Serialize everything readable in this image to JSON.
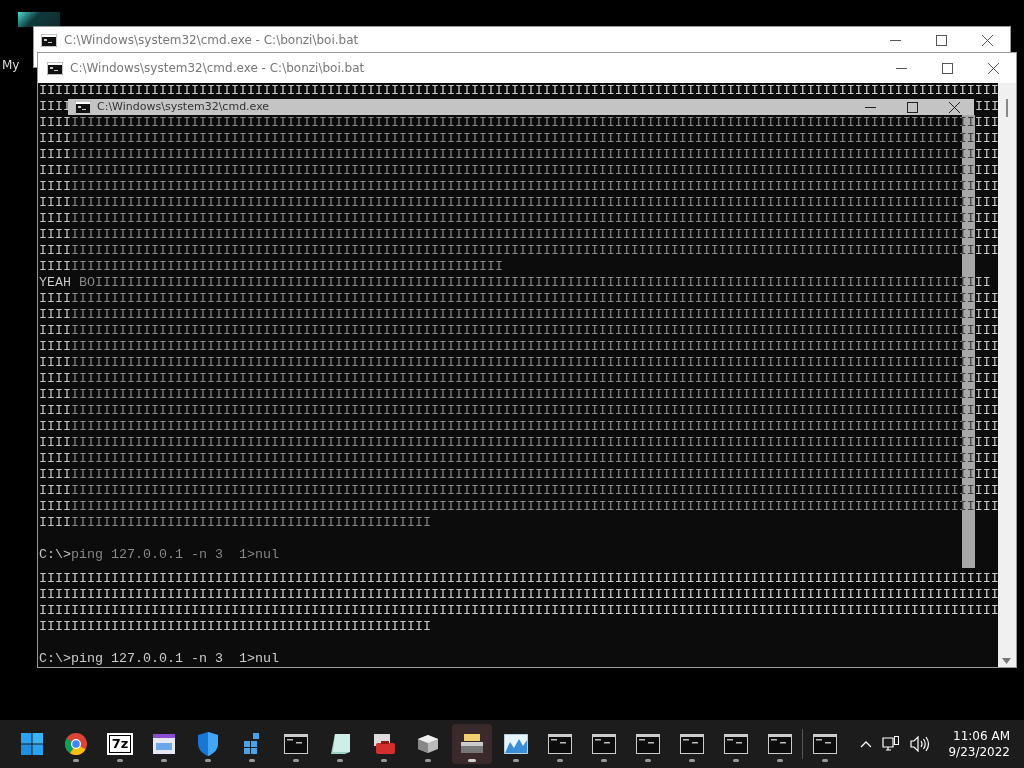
{
  "desktop": {
    "icon_labels": [
      "My"
    ]
  },
  "back_window": {
    "title": "C:\\Windows\\system32\\cmd.exe - C:\\bonzi\\boi.bat"
  },
  "front_window": {
    "title": "C:\\Windows\\system32\\cmd.exe - C:\\bonzi\\boi.bat",
    "console": [
      {
        "kind": "output",
        "dimmed": false,
        "lines": [
          "IIIIIIIIIIIIIIIIIIIIIIIIIIIIIIIIIIIIIIIIIIIIIIIIIIIIIIIIIIIIIIIIIIIIIIIIIIIIIIIIIIIIIIIIIIIIIIIIIIIIIIIIIIIIIIIIIIIIIIII"
        ]
      },
      {
        "kind": "covered",
        "left": "IIII",
        "right": "III"
      },
      {
        "kind": "output",
        "dimmed": true,
        "lines": [
          "IIIIIIIIIIIIIIIIIIIIIIIIIIIIIIIIIIIIIIIIIIIIIIIIIIIIIIIIIIIIIIIIIIIIIIIIIIIIIIIIIIIIIIIIIIIIIIIIIIIIIIIIIIIIIIIIIIIIIIII",
          "IIIIIIIIIIIIIIIIIIIIIIIIIIIIIIIIIIIIIIIIIIIIIIIIIIIIIIIIIIIIIIIIIIIIIIIIIIIIIIIIIIIIIIIIIIIIIIIIIIIIIIIIIIIIIIIIIIIIIIII",
          "IIIIIIIIIIIIIIIIIIIIIIIIIIIIIIIIIIIIIIIIIIIIIIIIIIIIIIIIIIIIIIIIIIIIIIIIIIIIIIIIIIIIIIIIIIIIIIIIIIIIIIIIIIIIIIIIIIIIIIII",
          "IIIIIIIIIIIIIIIIIIIIIIIIIIIIIIIIIIIIIIIIIIIIIIIIIIIIIIIIIIIIIIIIIIIIIIIIIIIIIIIIIIIIIIIIIIIIIIIIIIIIIIIIIIIIIIIIIIIIIIII",
          "IIIIIIIIIIIIIIIIIIIIIIIIIIIIIIIIIIIIIIIIIIIIIIIIIIIIIIIIIIIIIIIIIIIIIIIIIIIIIIIIIIIIIIIIIIIIIIIIIIIIIIIIIIIIIIIIIIIIIIII",
          "IIIIIIIIIIIIIIIIIIIIIIIIIIIIIIIIIIIIIIIIIIIIIIIIIIIIIIIIIIIIIIIIIIIIIIIIIIIIIIIIIIIIIIIIIIIIIIIIIIIIIIIIIIIIIIIIIIIIIIII",
          "IIIIIIIIIIIIIIIIIIIIIIIIIIIIIIIIIIIIIIIIIIIIIIIIIIIIIIIIIIIIIIIIIIIIIIIIIIIIIIIIIIIIIIIIIIIIIIIIIIIIIIIIIIIIIIIIIIIIIIII",
          "IIIIIIIIIIIIIIIIIIIIIIIIIIIIIIIIIIIIIIIIIIIIIIIIIIIIIIIIIIIIIIIIIIIIIIIIIIIIIIIIIIIIIIIIIIIIIIIIIIIIIIIIIIIIIIIIIIIIIIII",
          "IIIIIIIIIIIIIIIIIIIIIIIIIIIIIIIIIIIIIIIIIIIIIIIIIIIIIIIIIIIIIIIIIIIIIIIIIIIIIIIIIIIIIIIIIIIIIIIIIIIIIIIIIIIIIIIIIIIIIIII",
          "IIIIIIIIIIIIIIIIIIIIIIIIIIIIIIIIIIIIIIIIIIIIIIIIIIIIIIIIII",
          "YEAH BOIIIIIIIIIIIIIIIIIIIIIIIIIIIIIIIIIIIIIIIIIIIIIIIIIIIIIIIIIIIIIIIIIIIIIIIIIIIIIIIIIIIIIIIIIIIIIIIIIIIIIIIIIIIIIIII",
          "IIIIIIIIIIIIIIIIIIIIIIIIIIIIIIIIIIIIIIIIIIIIIIIIIIIIIIIIIIIIIIIIIIIIIIIIIIIIIIIIIIIIIIIIIIIIIIIIIIIIIIIIIIIIIIIIIIIIIIII",
          "IIIIIIIIIIIIIIIIIIIIIIIIIIIIIIIIIIIIIIIIIIIIIIIIIIIIIIIIIIIIIIIIIIIIIIIIIIIIIIIIIIIIIIIIIIIIIIIIIIIIIIIIIIIIIIIIIIIIIIII",
          "IIIIIIIIIIIIIIIIIIIIIIIIIIIIIIIIIIIIIIIIIIIIIIIIIIIIIIIIIIIIIIIIIIIIIIIIIIIIIIIIIIIIIIIIIIIIIIIIIIIIIIIIIIIIIIIIIIIIIIII",
          "IIIIIIIIIIIIIIIIIIIIIIIIIIIIIIIIIIIIIIIIIIIIIIIIIIIIIIIIIIIIIIIIIIIIIIIIIIIIIIIIIIIIIIIIIIIIIIIIIIIIIIIIIIIIIIIIIIIIIIII",
          "IIIIIIIIIIIIIIIIIIIIIIIIIIIIIIIIIIIIIIIIIIIIIIIIIIIIIIIIIIIIIIIIIIIIIIIIIIIIIIIIIIIIIIIIIIIIIIIIIIIIIIIIIIIIIIIIIIIIIIII",
          "IIIIIIIIIIIIIIIIIIIIIIIIIIIIIIIIIIIIIIIIIIIIIIIIIIIIIIIIIIIIIIIIIIIIIIIIIIIIIIIIIIIIIIIIIIIIIIIIIIIIIIIIIIIIIIIIIIIIIIII",
          "IIIIIIIIIIIIIIIIIIIIIIIIIIIIIIIIIIIIIIIIIIIIIIIIIIIIIIIIIIIIIIIIIIIIIIIIIIIIIIIIIIIIIIIIIIIIIIIIIIIIIIIIIIIIIIIIIIIIIIII",
          "IIIIIIIIIIIIIIIIIIIIIIIIIIIIIIIIIIIIIIIIIIIIIIIIIIIIIIIIIIIIIIIIIIIIIIIIIIIIIIIIIIIIIIIIIIIIIIIIIIIIIIIIIIIIIIIIIIIIIIII",
          "IIIIIIIIIIIIIIIIIIIIIIIIIIIIIIIIIIIIIIIIIIIIIIIIIIIIIIIIIIIIIIIIIIIIIIIIIIIIIIIIIIIIIIIIIIIIIIIIIIIIIIIIIIIIIIIIIIIIIIII",
          "IIIIIIIIIIIIIIIIIIIIIIIIIIIIIIIIIIIIIIIIIIIIIIIIIIIIIIIIIIIIIIIIIIIIIIIIIIIIIIIIIIIIIIIIIIIIIIIIIIIIIIIIIIIIIIIIIIIIIIII",
          "IIIIIIIIIIIIIIIIIIIIIIIIIIIIIIIIIIIIIIIIIIIIIIIIIIIIIIIIIIIIIIIIIIIIIIIIIIIIIIIIIIIIIIIIIIIIIIIIIIIIIIIIIIIIIIIIIIIIIIII",
          "IIIIIIIIIIIIIIIIIIIIIIIIIIIIIIIIIIIIIIIIIIIIIIIIIIIIIIIIIIIIIIIIIIIIIIIIIIIIIIIIIIIIIIIIIIIIIIIIIIIIIIIIIIIIIIIIIIIIIIII",
          "IIIIIIIIIIIIIIIIIIIIIIIIIIIIIIIIIIIIIIIIIIIIIIIIIIIIIIIIIIIIIIIIIIIIIIIIIIIIIIIIIIIIIIIIIIIIIIIIIIIIIIIIIIIIIIIIIIIIIIII",
          "IIIIIIIIIIIIIIIIIIIIIIIIIIIIIIIIIIIIIIIIIIIIIIIIIIIIIIIIIIIIIIIIIIIIIIIIIIIIIIIIIIIIIIIIIIIIIIIIIIIIIIIIIIIIIIIIIIIIIIII",
          "IIIIIIIIIIIIIIIIIIIIIIIIIIIIIIIIIIIIIIIIIIIIIIIII"
        ]
      },
      {
        "kind": "prompt",
        "dimmed": true,
        "text": "C:\\>ping 127.0.0.1 -n 3  1>nul"
      },
      {
        "kind": "output",
        "dimmed": false,
        "lines": [
          "IIIIIIIIIIIIIIIIIIIIIIIIIIIIIIIIIIIIIIIIIIIIIIIIIIIIIIIIIIIIIIIIIIIIIIIIIIIIIIIIIIIIIIIIIIIIIIIIIIIIIIIIIIIIIIIIIIIIIIII",
          "IIIIIIIIIIIIIIIIIIIIIIIIIIIIIIIIIIIIIIIIIIIIIIIIIIIIIIIIIIIIIIIIIIIIIIIIIIIIIIIIIIIIIIIIIIIIIIIIIIIIIIIIIIIIIIIIIIIIIIII",
          "IIIIIIIIIIIIIIIIIIIIIIIIIIIIIIIIIIIIIIIIIIIIIIIIIIIIIIIIIIIIIIIIIIIIIIIIIIIIIIIIIIIIIIIIIIIIIIIIIIIIIIIIIIIIIIIIIIIIIIII",
          "IIIIIIIIIIIIIIIIIIIIIIIIIIIIIIIIIIIIIIIIIIIIIIIII"
        ]
      },
      {
        "kind": "prompt",
        "dimmed": false,
        "text": "C:\\>ping 127.0.0.1 -n 3  1>nul"
      }
    ]
  },
  "ghost_window": {
    "title": "C:\\Windows\\system32\\cmd.exe"
  },
  "taskbar": {
    "items": [
      {
        "kind": "start",
        "running": false,
        "selected": false
      },
      {
        "kind": "browser",
        "running": true,
        "selected": false
      },
      {
        "kind": "archiver",
        "label": "7z",
        "running": true,
        "selected": false
      },
      {
        "kind": "app-window",
        "running": true,
        "selected": false
      },
      {
        "kind": "shield",
        "running": true,
        "selected": false
      },
      {
        "kind": "cubes",
        "running": true,
        "selected": false
      },
      {
        "kind": "console",
        "running": true,
        "selected": false
      },
      {
        "kind": "notepad",
        "running": true,
        "selected": false
      },
      {
        "kind": "toolbox",
        "running": true,
        "selected": false
      },
      {
        "kind": "dice",
        "running": true,
        "selected": false
      },
      {
        "kind": "scanner",
        "running": true,
        "selected": true
      },
      {
        "kind": "chart",
        "running": true,
        "selected": false
      },
      {
        "kind": "console",
        "running": true,
        "selected": false
      },
      {
        "kind": "console",
        "running": true,
        "selected": false
      },
      {
        "kind": "console",
        "running": true,
        "selected": false
      },
      {
        "kind": "console",
        "running": true,
        "selected": false
      },
      {
        "kind": "console",
        "running": true,
        "selected": false
      },
      {
        "kind": "console",
        "running": true,
        "selected": false
      },
      {
        "kind": "divider"
      },
      {
        "kind": "console",
        "running": true,
        "selected": false
      }
    ],
    "clock": {
      "time": "11:06 AM",
      "date": "9/23/2022"
    }
  }
}
